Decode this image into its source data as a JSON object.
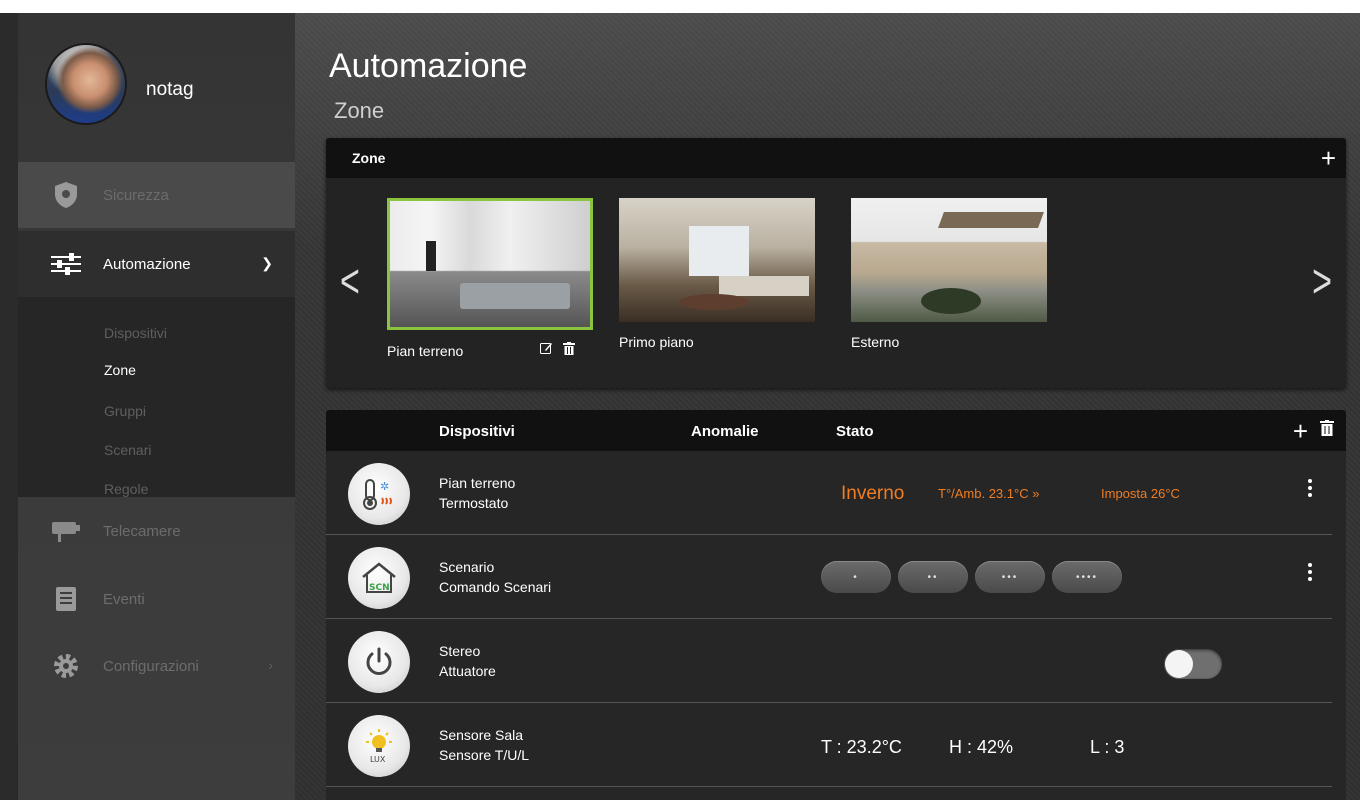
{
  "user": {
    "name": "notag"
  },
  "nav": {
    "sicurezza": "Sicurezza",
    "automazione": "Automazione",
    "sub": [
      "Dispositivi",
      "Zone",
      "Gruppi",
      "Scenari",
      "Regole"
    ],
    "telecamere": "Telecamere",
    "eventi": "Eventi",
    "configurazioni": "Configurazioni"
  },
  "header": {
    "title": "Automazione",
    "subtitle": "Zone"
  },
  "zones": {
    "title": "Zone",
    "items": [
      {
        "label": "Pian terreno",
        "selected": true
      },
      {
        "label": "Primo piano"
      },
      {
        "label": "Esterno"
      }
    ]
  },
  "devices": {
    "headers": {
      "name": "Dispositivi",
      "anomalies": "Anomalie",
      "state": "Stato"
    },
    "rows": [
      {
        "line1": "Pian terreno",
        "line2": "Termostato",
        "mode": "Inverno",
        "amb": "T°/Amb. 23.1°C »",
        "set": "Imposta 26°C"
      },
      {
        "line1": "Scenario",
        "line2": "Comando Scenari",
        "buttons": [
          "•",
          "••",
          "•••",
          "••••"
        ]
      },
      {
        "line1": "Stereo",
        "line2": "Attuatore",
        "toggle_on": false
      },
      {
        "line1": "Sensore Sala",
        "line2": "Sensore T/U/L",
        "t": "T : 23.2°C",
        "h": "H : 42%",
        "l": "L : 3",
        "icon_label": "LUX"
      }
    ],
    "scn_icon_label": "SCN"
  },
  "colors": {
    "accent": "#f07d22",
    "selected": "#8bc53f"
  }
}
